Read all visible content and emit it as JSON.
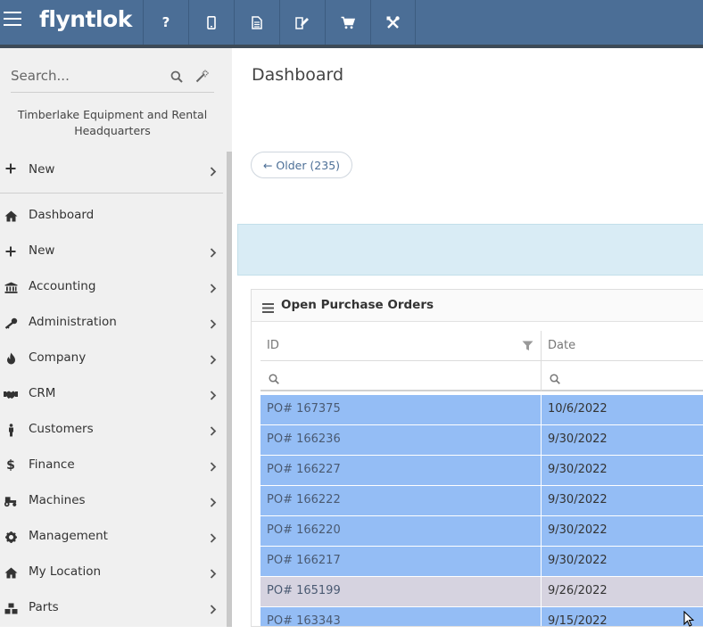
{
  "header": {
    "logo": "flyntlok",
    "nav_icons": [
      "help-icon",
      "mobile-icon",
      "document-icon",
      "edit-document-icon",
      "cart-icon",
      "tools-icon"
    ],
    "nav_labels": {
      "help": "?"
    },
    "colors": {
      "bar": "#4b6e96"
    }
  },
  "sidebar": {
    "search_placeholder": "Search...",
    "company_line1": "Timberlake Equipment and Rental",
    "company_line2": "Headquarters",
    "new_top_label": "New",
    "items": [
      {
        "label": "Dashboard",
        "icon": "home-icon",
        "has_submenu": false
      },
      {
        "label": "New",
        "icon": "plus-icon",
        "has_submenu": true
      },
      {
        "label": "Accounting",
        "icon": "bank-icon",
        "has_submenu": true
      },
      {
        "label": "Administration",
        "icon": "key-icon",
        "has_submenu": true
      },
      {
        "label": "Company",
        "icon": "flame-icon",
        "has_submenu": true
      },
      {
        "label": "CRM",
        "icon": "handshake-icon",
        "has_submenu": true
      },
      {
        "label": "Customers",
        "icon": "person-icon",
        "has_submenu": true
      },
      {
        "label": "Finance",
        "icon": "dollar-icon",
        "has_submenu": true
      },
      {
        "label": "Machines",
        "icon": "tractor-icon",
        "has_submenu": true
      },
      {
        "label": "Management",
        "icon": "gear-icon",
        "has_submenu": true
      },
      {
        "label": "My Location",
        "icon": "home-icon",
        "has_submenu": true
      },
      {
        "label": "Parts",
        "icon": "boxes-icon",
        "has_submenu": true
      }
    ]
  },
  "main": {
    "title": "Dashboard",
    "older_button": "← Older (235)"
  },
  "panel": {
    "title": "Open Purchase Orders",
    "columns": {
      "id": "ID",
      "date": "Date"
    },
    "rows": [
      {
        "id": "PO# 167375",
        "date": "10/6/2022",
        "state": "selected"
      },
      {
        "id": "PO# 166236",
        "date": "9/30/2022",
        "state": "selected"
      },
      {
        "id": "PO# 166227",
        "date": "9/30/2022",
        "state": "selected"
      },
      {
        "id": "PO# 166222",
        "date": "9/30/2022",
        "state": "selected"
      },
      {
        "id": "PO# 166220",
        "date": "9/30/2022",
        "state": "selected"
      },
      {
        "id": "PO# 166217",
        "date": "9/30/2022",
        "state": "selected"
      },
      {
        "id": "PO# 165199",
        "date": "9/26/2022",
        "state": "hover"
      },
      {
        "id": "PO# 163343",
        "date": "9/15/2022",
        "state": "selected"
      }
    ],
    "colors": {
      "selected": "#94bdf5",
      "hover": "#d6d3e0"
    }
  }
}
